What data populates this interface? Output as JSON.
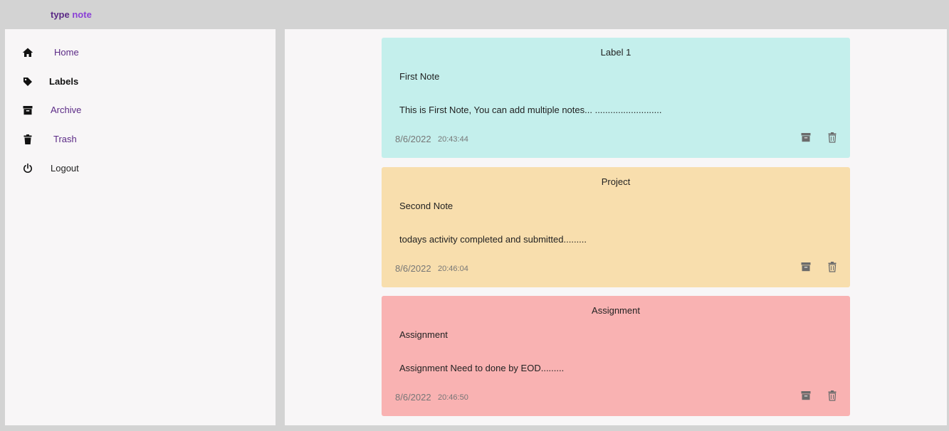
{
  "brand": {
    "part1": "type",
    "part2": "note"
  },
  "sidebar": {
    "items": [
      {
        "label": "Home",
        "icon": "home-icon",
        "color": "#5b2a86"
      },
      {
        "label": "Labels",
        "icon": "tag-icon",
        "color": "#111111"
      },
      {
        "label": "Archive",
        "icon": "archive-icon",
        "color": "#5b2a86"
      },
      {
        "label": "Trash",
        "icon": "trash-icon",
        "color": "#5b2a86"
      },
      {
        "label": "Logout",
        "icon": "power-icon",
        "color": "#222222"
      }
    ]
  },
  "notes": [
    {
      "label": "Label 1",
      "title": "First Note",
      "content": "This is First Note, You can add multiple notes... ..........................",
      "date": "8/6/2022",
      "time": "20:43:44",
      "color": "#c4efec"
    },
    {
      "label": "Project",
      "title": "Second Note",
      "content": "todays activity completed and submitted.........",
      "date": "8/6/2022",
      "time": "20:46:04",
      "color": "#f8dead"
    },
    {
      "label": "Assignment",
      "title": "Assignment",
      "content": "Assignment Need to done by EOD.........",
      "date": "8/6/2022",
      "time": "20:46:50",
      "color": "#f9b2b2"
    }
  ]
}
